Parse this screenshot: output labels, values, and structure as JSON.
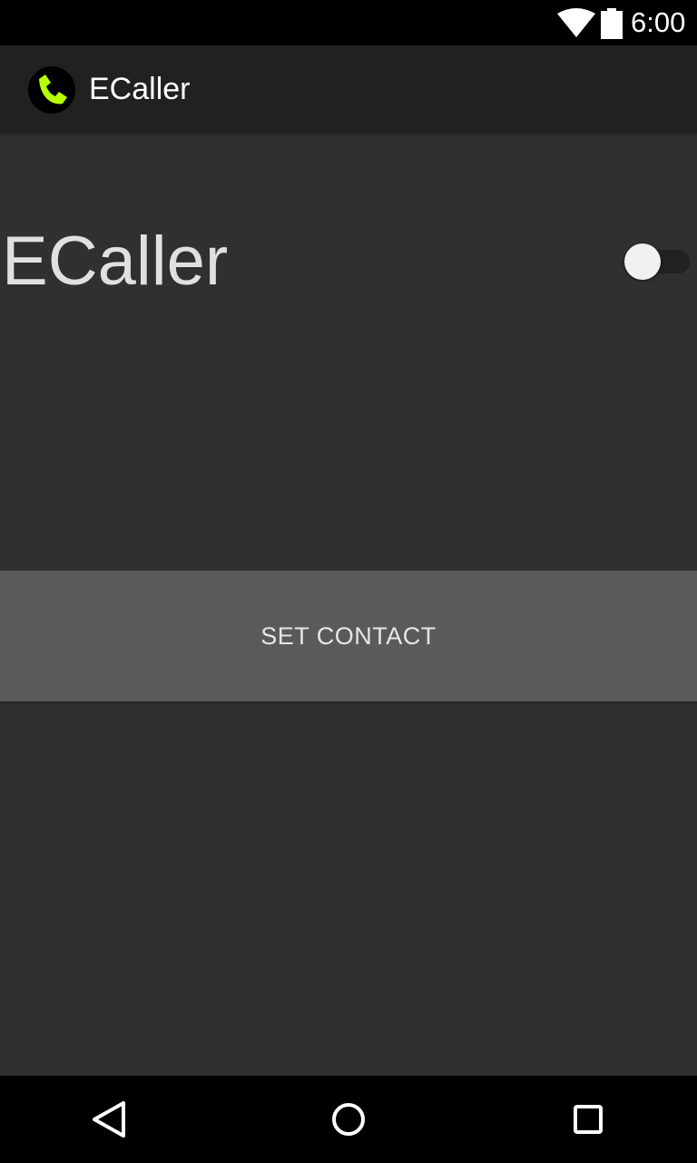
{
  "status_bar": {
    "time": "6:00",
    "icons": [
      "wifi-icon",
      "battery-icon"
    ]
  },
  "action_bar": {
    "title": "ECaller",
    "icon": "phone-app-icon",
    "icon_colors": {
      "background": "#000000",
      "handset": "#b6ff00"
    }
  },
  "main": {
    "label": "ECaller",
    "toggle": {
      "checked": false
    },
    "set_contact_button": "SET CONTACT"
  },
  "nav_bar": {
    "icons": [
      "back-icon",
      "home-icon",
      "recents-icon"
    ]
  },
  "colors": {
    "background": "#303030",
    "action_bar": "#212121",
    "button": "#5a5a5c"
  }
}
